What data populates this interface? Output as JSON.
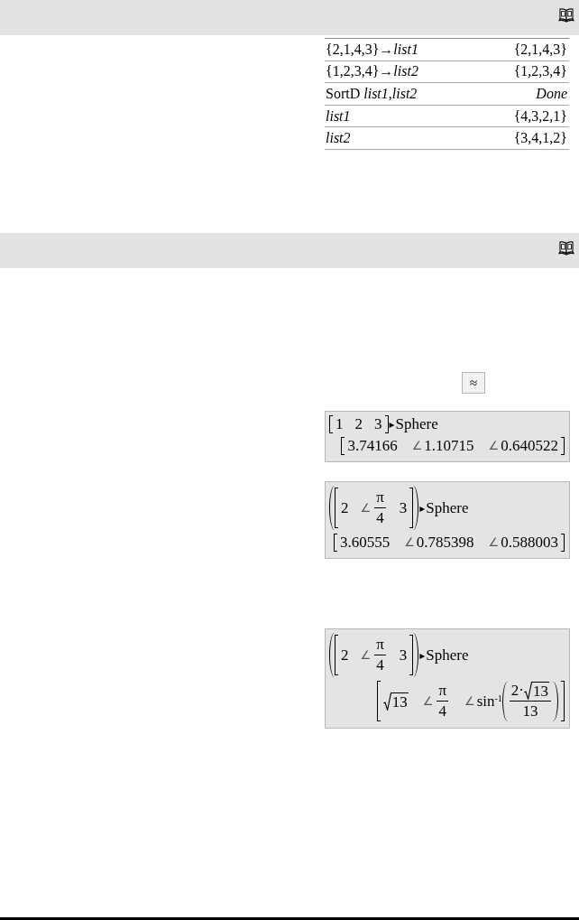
{
  "sections": [
    {
      "kind": "table",
      "rows": [
        {
          "input": {
            "text": "{2,1,4,3}→*list1*",
            "italic": false
          },
          "output": {
            "text": "{2,1,4,3}",
            "italic": false
          }
        },
        {
          "input": {
            "text": "{1,2,3,4}→*list2*",
            "italic": false
          },
          "output": {
            "text": "{1,2,3,4}",
            "italic": false
          }
        },
        {
          "input": {
            "text": "SortD *list1*,*list2*",
            "italic": false
          },
          "output": {
            "text": "Done",
            "italic": true
          }
        },
        {
          "input": {
            "text": "list1",
            "italic": true
          },
          "output": {
            "text": "{4,3,2,1}",
            "italic": false
          }
        },
        {
          "input": {
            "text": "list2",
            "italic": true
          },
          "output": {
            "text": "{3,4,1,2}",
            "italic": false
          }
        }
      ]
    },
    {
      "kind": "examples",
      "mode_button": "≈",
      "boxes": [
        {
          "input": {
            "parenthesized": false,
            "entries": [
              {
                "kind": "text",
                "text": "1"
              },
              {
                "kind": "text",
                "text": "2"
              },
              {
                "kind": "text",
                "text": "3"
              }
            ],
            "operator": "▸",
            "command": "Sphere"
          },
          "output": {
            "entries": [
              {
                "kind": "text",
                "text": "3.74166"
              },
              {
                "kind": "text",
                "prefix": "∠",
                "text": "1.10715"
              },
              {
                "kind": "text",
                "prefix": "∠",
                "text": "0.640522"
              }
            ]
          }
        },
        {
          "input": {
            "parenthesized": true,
            "entries": [
              {
                "kind": "text",
                "text": "2"
              },
              {
                "kind": "fraction",
                "prefix": "∠",
                "numerator": "π",
                "denominator": "4"
              },
              {
                "kind": "text",
                "text": "3"
              }
            ],
            "operator": "▸",
            "command": "Sphere"
          },
          "output": {
            "entries": [
              {
                "kind": "text",
                "text": "3.60555"
              },
              {
                "kind": "text",
                "prefix": "∠",
                "text": "0.785398"
              },
              {
                "kind": "text",
                "prefix": "∠",
                "text": "0.588003"
              }
            ]
          }
        },
        {
          "input": {
            "parenthesized": true,
            "entries": [
              {
                "kind": "text",
                "text": "2"
              },
              {
                "kind": "fraction",
                "prefix": "∠",
                "numerator": "π",
                "denominator": "4"
              },
              {
                "kind": "text",
                "text": "3"
              }
            ],
            "operator": "▸",
            "command": "Sphere"
          },
          "output": {
            "entries": [
              {
                "kind": "sqrt",
                "radicand": "13"
              },
              {
                "kind": "fraction",
                "prefix": "∠",
                "numerator": "π",
                "denominator": "4"
              },
              {
                "kind": "function",
                "prefix": "∠",
                "name": "sin$^{-1}$",
                "numerator": [
                  {
                    "kind": "text",
                    "text": "2·"
                  },
                  {
                    "kind": "sqrt",
                    "radicand": "13"
                  }
                ],
                "denominator": "13"
              }
            ]
          }
        }
      ]
    }
  ]
}
